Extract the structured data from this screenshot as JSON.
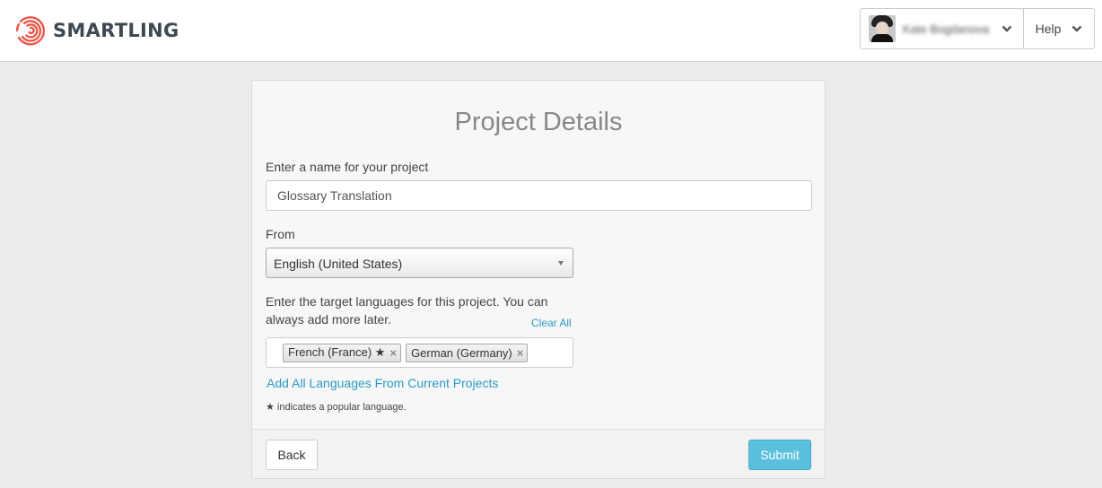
{
  "header": {
    "logo_text": "SMARTLING",
    "logo_color": "#e8584a",
    "user_name": "Kate Bogdanova",
    "help_label": "Help"
  },
  "form": {
    "title": "Project Details",
    "name_label": "Enter a name for your project",
    "name_value": "Glossary Translation",
    "from_label": "From",
    "from_selected": "English (United States)",
    "target_label": "Enter the target languages for this project. You can always add more later.",
    "clear_all": "Clear All",
    "target_languages": [
      {
        "label": "French (France) ★",
        "remove": "×"
      },
      {
        "label": "German (Germany)",
        "remove": "×"
      }
    ],
    "add_all_link": "Add All Languages From Current Projects",
    "popular_note": "★ indicates a popular language.",
    "back_label": "Back",
    "submit_label": "Submit",
    "submit_color": "#5bc0de"
  }
}
